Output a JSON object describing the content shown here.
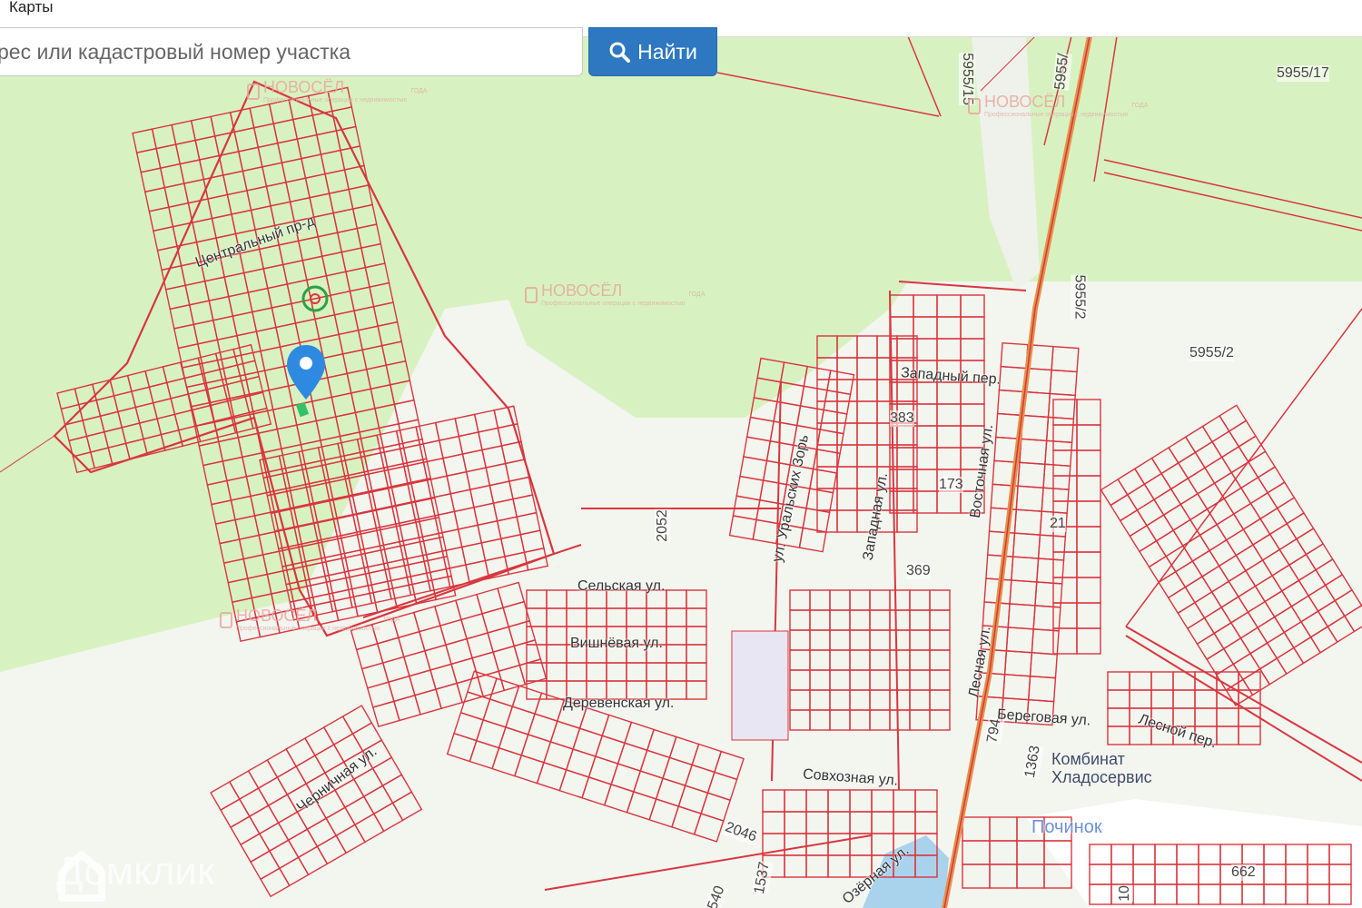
{
  "window": {
    "title": "Карты"
  },
  "search": {
    "placeholder": "рес или кадастровый номер участка",
    "button_label": "Найти"
  },
  "watermarks": {
    "brand": "НОВОСЁЛ",
    "tagline": "Профессиональные операции с недвижимостью",
    "badge": "ГОДА",
    "domclick": "Домклик"
  },
  "streets": [
    "Центральный пр-д",
    "Сельская ул.",
    "Вишнёвая ул.",
    "Деревенская ул.",
    "Черничная ул.",
    "ул. Уральских Зорь",
    "Западная ул.",
    "Западный пер.",
    "Восточная ул.",
    "Лесная ул.",
    "Береговая ул.",
    "Лесной пер.",
    "Совхозная ул.",
    "Озёрная ул."
  ],
  "parcel_numbers": [
    "5955/15",
    "5955/",
    "5955/17",
    "5955/2",
    "5955/2",
    "383",
    "173",
    "21",
    "369",
    "2052",
    "2046",
    "1537",
    "794",
    "1363",
    "662",
    "540",
    "10"
  ],
  "places": [
    "Комбинат Хладосервис",
    "Починок"
  ],
  "colors": {
    "map_green": "#d7f2c0",
    "map_light": "#f3f7ef",
    "parcel_red": "#d9363e",
    "road_orange": "#e6914a",
    "button_blue": "#2d78c0",
    "pin_blue": "#2e8ae0",
    "water": "#a9d3ec"
  },
  "pin": {
    "icon": "map-pin-icon"
  }
}
